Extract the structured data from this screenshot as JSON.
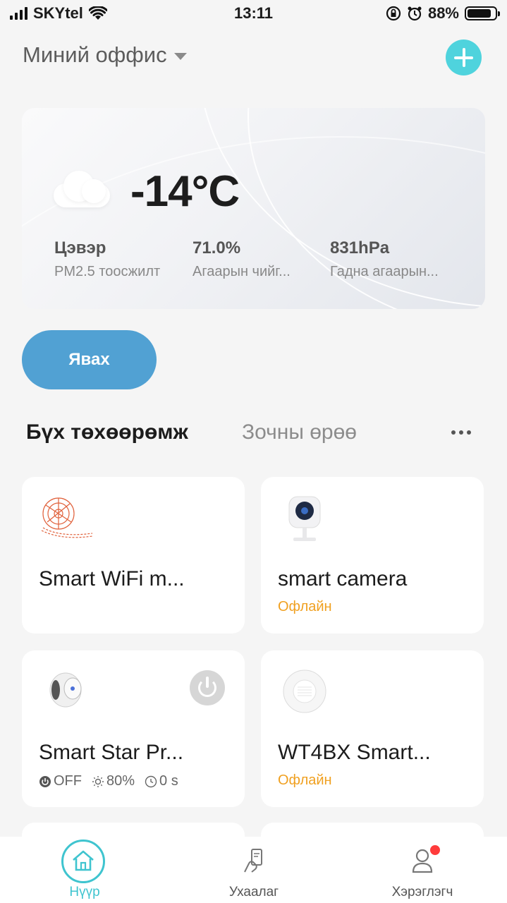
{
  "status_bar": {
    "carrier": "SKYtel",
    "time": "13:11",
    "battery": "88%",
    "battery_level": 0.88
  },
  "header": {
    "home_name": "Миний оффис"
  },
  "weather": {
    "temperature": "-14°C",
    "stats": [
      {
        "value": "Цэвэр",
        "label": "PM2.5 тоосжилт"
      },
      {
        "value": "71.0%",
        "label": "Агаарын чийг..."
      },
      {
        "value": "831hPa",
        "label": "Гадна агаарын..."
      }
    ]
  },
  "go_button": "Явах",
  "tabs": {
    "all": "Бүх төхөөрөмж",
    "guest": "Зочны өрөө"
  },
  "devices": [
    {
      "name": "Smart WiFi m...",
      "status": "",
      "icon": "led-strip-icon"
    },
    {
      "name": "smart camera",
      "status": "Офлайн",
      "icon": "camera-icon"
    },
    {
      "name": "Smart Star Pr...",
      "status": "",
      "icon": "projector-icon",
      "power": "OFF",
      "brightness": "80%",
      "timer": "0 s"
    },
    {
      "name": "WT4BX Smart...",
      "status": "Офлайн",
      "icon": "smoke-detector-icon"
    }
  ],
  "nav": [
    {
      "label": "Нүүр",
      "icon": "home-icon",
      "active": true
    },
    {
      "label": "Ухаалаг",
      "icon": "smart-scene-icon",
      "active": false
    },
    {
      "label": "Хэрэглэгч",
      "icon": "user-icon",
      "active": false
    }
  ],
  "colors": {
    "accent": "#4fd3dd",
    "go_button": "#51a1d3",
    "offline": "#f0a020",
    "nav_active": "#3fc4cf"
  }
}
